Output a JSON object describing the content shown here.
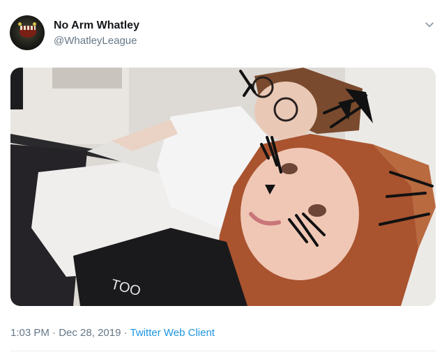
{
  "tweet": {
    "author_name": "No Arm Whatley",
    "author_handle": "@WhatleyLeague",
    "time": "1:03 PM",
    "separator": "·",
    "date": "Dec 28, 2019",
    "client": "Twitter Web Client",
    "shirt_text": "TOO"
  },
  "colors": {
    "text_primary": "#14171a",
    "text_secondary": "#657786",
    "link": "#1b95e0"
  },
  "icons": {
    "menu": "chevron-down-icon"
  }
}
